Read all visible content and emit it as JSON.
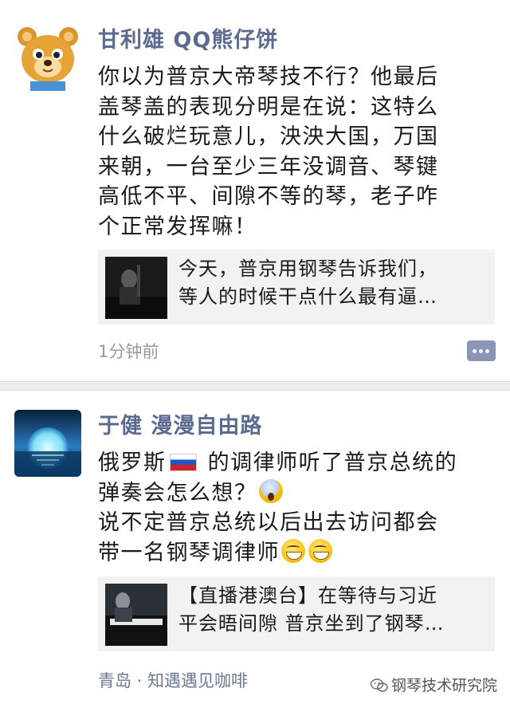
{
  "posts": [
    {
      "author": "甘利雄 QQ熊仔饼",
      "avatar_icon": "teddy-bear-avatar",
      "lines": [
        "你以为普京大帝琴技不行？他最后",
        "盖琴盖的表现分明是在说：这特么",
        "什么破烂玩意儿，泱泱大国，万国",
        "来朝，一台至少三年没调音、琴键",
        "高低不平、间隙不等的琴，老子咋",
        "个正常发挥嘛！"
      ],
      "link": {
        "line1": "今天，普京用钢琴告诉我们，",
        "line2": "等人的时候干点什么最有逼…"
      },
      "time": "1分钟前",
      "comment_icon": "comment-icon"
    },
    {
      "author": "于健 漫漫自由路",
      "avatar_icon": "sunset-sea-avatar",
      "line1_before": "俄罗斯",
      "flag_icon": "russia-flag-icon",
      "line1_after": " 的调律师听了普京总统的",
      "line2": "弹奏会怎么想？",
      "line2_emoji": "scream-emoji-icon",
      "line3": "说不定普京总统以后出去访问都会",
      "line4": "带一名钢琴调律师",
      "line4_emoji": "grin-emoji-icon",
      "link": {
        "line1": "【直播港澳台】在等待与习近",
        "line2": "平会晤间隙 普京坐到了钢琴…"
      },
      "location": "青岛 · 知遇遇见咖啡"
    }
  ],
  "watermark": "钢琴技术研究院",
  "colors": {
    "name": "#5b6b8f",
    "meta": "#9a9a9a",
    "card_bg": "#f2f2f2",
    "separator": "#ededed"
  }
}
